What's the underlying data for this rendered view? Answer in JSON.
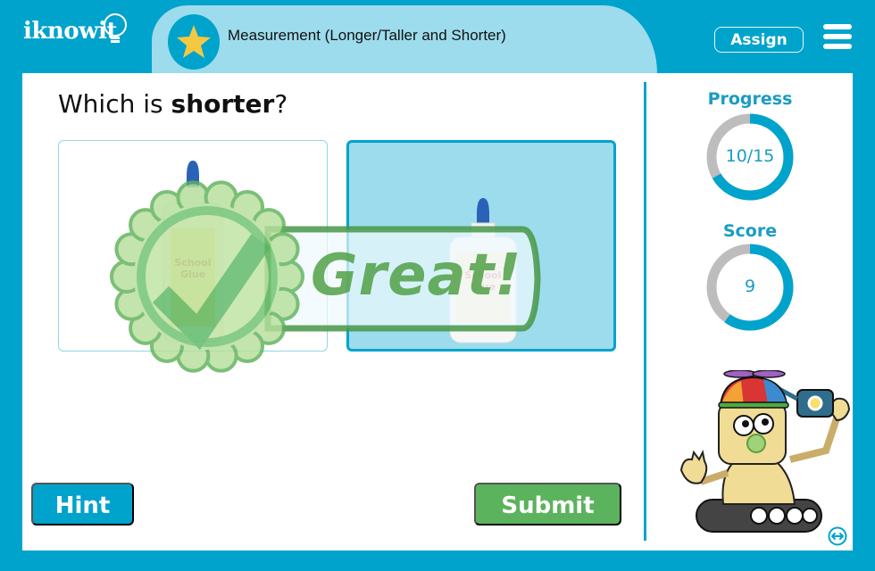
{
  "header": {
    "logo_text": "iknowit",
    "title": "Measurement (Longer/Taller and Shorter)",
    "assign_label": "Assign",
    "icons": {
      "lesson": "star-icon",
      "menu": "hamburger-menu-icon"
    }
  },
  "question": {
    "prefix": "Which is ",
    "emphasis": "shorter",
    "suffix": "?"
  },
  "choices": [
    {
      "id": "taller-glue",
      "label_line1": "School",
      "label_line2": "Glue",
      "selected": false
    },
    {
      "id": "shorter-glue",
      "label_line1": "School",
      "label_line2": "Glue",
      "selected": true
    }
  ],
  "feedback": {
    "message": "Great!",
    "icon": "check-seal-icon"
  },
  "buttons": {
    "hint": "Hint",
    "submit": "Submit"
  },
  "sidebar": {
    "progress": {
      "label": "Progress",
      "value_text": "10/15",
      "current": 10,
      "total": 15
    },
    "score": {
      "label": "Score",
      "value_text": "9",
      "fraction": 0.6
    },
    "mascot": "robot-mascot",
    "expand_icon": "expand-arrows-icon"
  },
  "colors": {
    "brand": "#00a3cc",
    "pill": "#9ddcec",
    "success": "#5cb35d",
    "ring_track": "#bdbdbd",
    "star": "#f5c842"
  }
}
